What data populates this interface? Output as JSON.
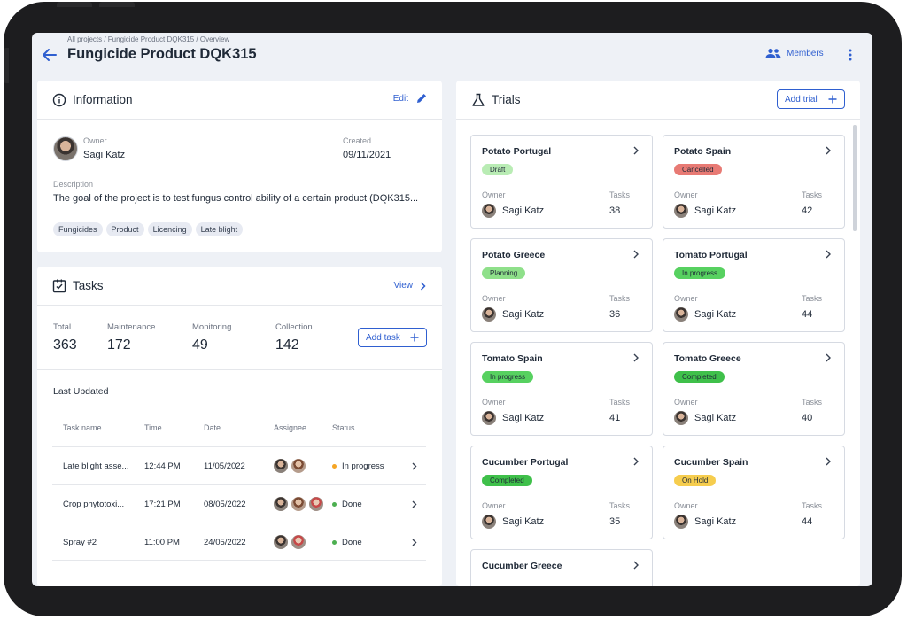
{
  "header": {
    "breadcrumb": "All projects / Fungicide Product DQK315 / Overview",
    "title": "Fungicide Product DQK315",
    "members_label": "Members"
  },
  "information": {
    "title": "Information",
    "edit_label": "Edit",
    "owner_label": "Owner",
    "owner_name": "Sagi Katz",
    "created_label": "Created",
    "created_value": "09/11/2021",
    "description_label": "Description",
    "description": "The goal of the project is to test fungus control ability of a certain product (DQK315...",
    "tags": [
      "Fungicides",
      "Product",
      "Licencing",
      "Late blight"
    ]
  },
  "tasks": {
    "title": "Tasks",
    "view_label": "View",
    "stats": [
      {
        "label": "Total",
        "value": "363"
      },
      {
        "label": "Maintenance",
        "value": "172"
      },
      {
        "label": "Monitoring",
        "value": "49"
      },
      {
        "label": "Collection",
        "value": "142"
      }
    ],
    "add_label": "Add task",
    "last_updated_label": "Last Updated",
    "columns": [
      "Task name",
      "Time",
      "Date",
      "Assignee",
      "Status"
    ],
    "rows": [
      {
        "name": "Late blight asse...",
        "time": "12:44 PM",
        "date": "11/05/2022",
        "status": "In progress",
        "status_color": "#f5a524"
      },
      {
        "name": "Crop phytotoxi...",
        "time": "17:21 PM",
        "date": "08/05/2022",
        "status": "Done",
        "status_color": "#4caf50"
      },
      {
        "name": "Spray #2",
        "time": "11:00 PM",
        "date": "24/05/2022",
        "status": "Done",
        "status_color": "#4caf50"
      }
    ]
  },
  "trials": {
    "title": "Trials",
    "add_label": "Add trial",
    "owner_label": "Owner",
    "tasks_label": "Tasks",
    "items": [
      {
        "name": "Potato Portugal",
        "status": "Draft",
        "color": "#b9ecb4",
        "owner": "Sagi Katz",
        "tasks": "38"
      },
      {
        "name": "Potato Spain",
        "status": "Cancelled",
        "color": "#e87a74",
        "owner": "Sagi Katz",
        "tasks": "42"
      },
      {
        "name": "Potato Greece",
        "status": "Planning",
        "color": "#8fe08a",
        "owner": "Sagi Katz",
        "tasks": "36"
      },
      {
        "name": "Tomato Portugal",
        "status": "In progress",
        "color": "#57d160",
        "owner": "Sagi Katz",
        "tasks": "44"
      },
      {
        "name": "Tomato Spain",
        "status": "In progress",
        "color": "#57d160",
        "owner": "Sagi Katz",
        "tasks": "41"
      },
      {
        "name": "Tomato Greece",
        "status": "Completed",
        "color": "#3fc04a",
        "owner": "Sagi Katz",
        "tasks": "40"
      },
      {
        "name": "Cucumber Portugal",
        "status": "Completed",
        "color": "#3fc04a",
        "owner": "Sagi Katz",
        "tasks": "35"
      },
      {
        "name": "Cucumber Spain",
        "status": "On Hold",
        "color": "#f6cd4e",
        "owner": "Sagi Katz",
        "tasks": "44"
      },
      {
        "name": "Cucumber Greece"
      }
    ]
  },
  "colors": {
    "accent": "#2f5fd0",
    "background": "#eef1f6",
    "device": "#1d1d1f"
  }
}
